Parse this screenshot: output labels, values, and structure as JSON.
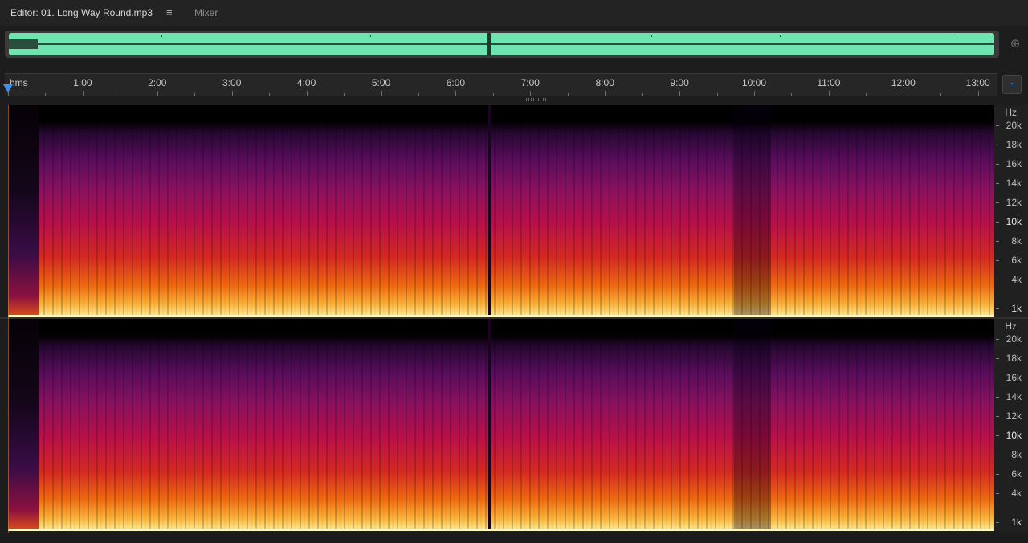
{
  "tabs": {
    "editor_label": "Editor: 01. Long Way Round.mp3",
    "editor_menu_icon": "≡",
    "mixer_label": "Mixer"
  },
  "overview": {
    "wave_color": "#6fe3b0",
    "zoom_icon": "zoom-selection-icon"
  },
  "ruler": {
    "unit_label": "hms",
    "labels": [
      "1:00",
      "2:00",
      "3:00",
      "4:00",
      "5:00",
      "6:00",
      "7:00",
      "8:00",
      "9:00",
      "10:00",
      "11:00",
      "12:00",
      "13:00"
    ],
    "snap_icon": "magnet-icon"
  },
  "frequency_axis": {
    "unit_label": "Hz",
    "labels": [
      "20k",
      "18k",
      "16k",
      "14k",
      "12k",
      "10k",
      "8k",
      "6k",
      "4k",
      "1k"
    ]
  },
  "colors": {
    "background": "#1d1d1d",
    "accent": "#3b8ff2",
    "spectral_hot": "#fff0a0",
    "spectral_mid": "#d42a22",
    "spectral_cold": "#5a0d5e"
  }
}
